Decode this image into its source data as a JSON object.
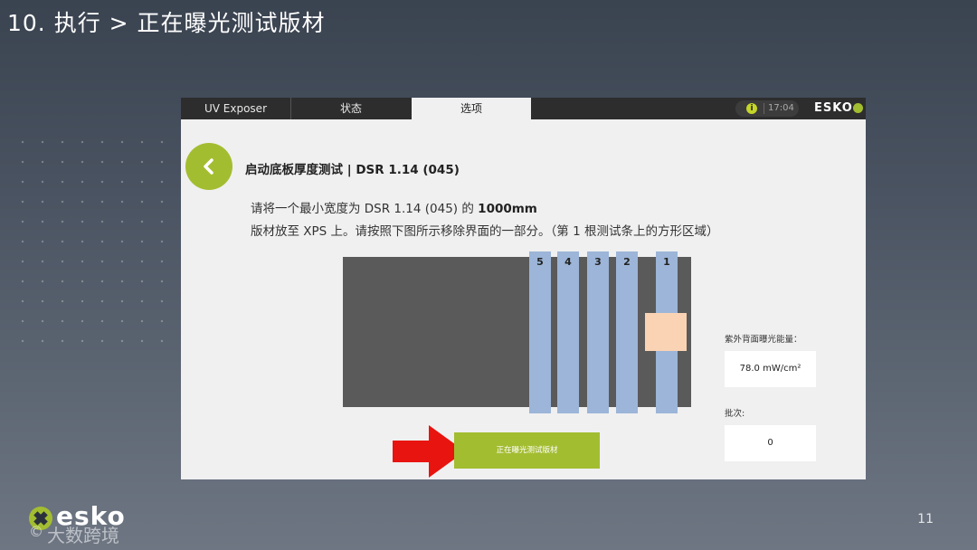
{
  "slide": {
    "title": "10. 执行 > 正在曝光测试版材",
    "page_number": "11",
    "brand_text": "esko",
    "watermark": "大数跨境",
    "watermark_prefix": "©"
  },
  "app": {
    "tabs": [
      {
        "label": "UV Exposer"
      },
      {
        "label": "状态"
      },
      {
        "label": "选项"
      }
    ],
    "active_tab": "选项",
    "time": "17:04",
    "logo_text": "ESKO",
    "info_icon": "i"
  },
  "content": {
    "heading": "启动底板厚度测试 | DSR 1.14 (045)",
    "instruction_line1_prefix": "请将一个最小宽度为 DSR 1.14 (045) 的",
    "instruction_line1_value": "1000mm",
    "instruction_line2": "版材放至 XPS 上。请按照下图所示移除界面的一部分。（第 1 根测试条上的方形区域）",
    "strips": [
      {
        "label": "5"
      },
      {
        "label": "4"
      },
      {
        "label": "3"
      },
      {
        "label": "2"
      },
      {
        "label": "1"
      }
    ],
    "energy_label": "紫外背面曝光能量：",
    "energy_value": "78.0 mW/cm²",
    "batch_label": "批次:",
    "batch_value": "0",
    "status_button": "正在曝光测试版材"
  },
  "icons": {
    "back": "chevron-left-icon",
    "info": "info-icon",
    "arrow": "red-arrow-icon"
  },
  "colors": {
    "accent_green": "#a3bd31",
    "strip_blue": "#9cb5d8",
    "highlight_peach": "#f9d3b3",
    "arrow_red": "#e8140f",
    "plate_gray": "#5a5a5a"
  }
}
